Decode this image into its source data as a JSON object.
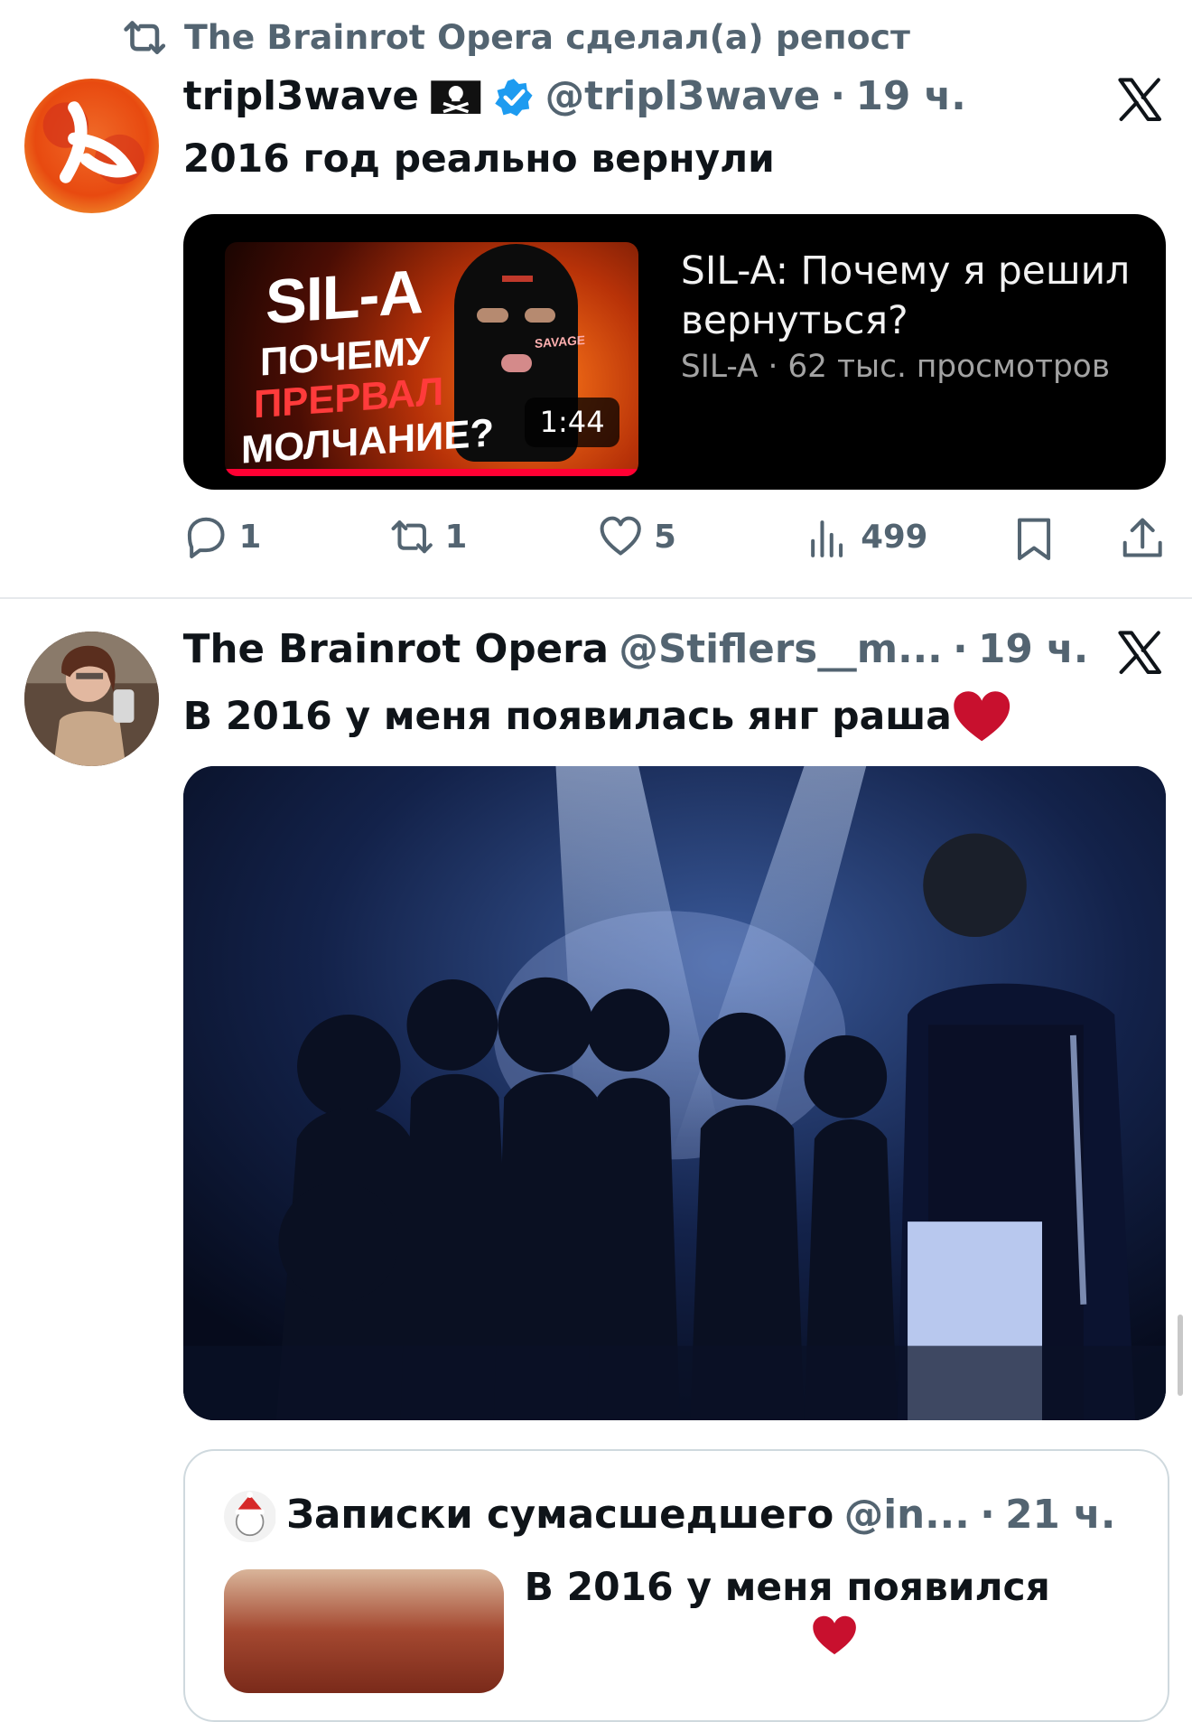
{
  "repost_banner": {
    "text": "The Brainrot Opera сделал(а) репост",
    "icon": "repost-icon"
  },
  "tweet1": {
    "author": {
      "name": "tripl3wave",
      "flag_emoji": "🏴‍☠️",
      "verified": true,
      "handle": "@tripl3wave",
      "separator": "·",
      "time": "19 ч."
    },
    "text": "2016 год реально вернули",
    "card": {
      "thumbnail_text": {
        "title": "SIL-A",
        "line1": "ПОЧЕМУ",
        "line2": "ПРЕРВАЛ",
        "line3": "МОЛЧАНИЕ?",
        "badge": "SAVAGE"
      },
      "duration": "1:44",
      "title": "SIL-A: Почему я решил вернуться?",
      "meta": "SIL-A · 62 тыс. просмотров"
    },
    "actions": {
      "replies": "1",
      "reposts": "1",
      "likes": "5",
      "views": "499"
    }
  },
  "tweet2": {
    "author": {
      "name": "The Brainrot Opera",
      "handle": "@Stiflers__m...",
      "separator": "·",
      "time": "19 ч."
    },
    "text": "В 2016 у меня появилась янг раша",
    "emoji": "❤️",
    "media": "photo-concert-crowd",
    "quote": {
      "author": {
        "name": "Записки сумасшедшего",
        "handle": "@in...",
        "separator": "·",
        "time": "21 ч."
      },
      "text": "В 2016 у меня появился"
    }
  },
  "colors": {
    "text": "#0f1419",
    "secondary": "#536471",
    "verified": "#1d9bf0",
    "divider": "#e6e9ec",
    "card_bg": "#000000"
  }
}
